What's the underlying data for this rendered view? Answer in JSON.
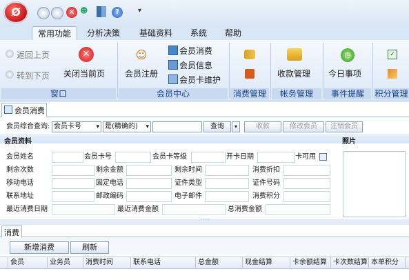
{
  "ribbon": {
    "tabs": [
      "常用功能",
      "分析决策",
      "基础资料",
      "系统",
      "帮助"
    ],
    "active_tab": "常用功能",
    "window_group": {
      "label": "窗口",
      "prev": "返回上页",
      "next": "转到下页",
      "close": "关闭当前页"
    },
    "member_group": {
      "label": "会员中心",
      "register": "会员注册",
      "consume": "会员消费",
      "info": "会员信息",
      "card": "会员卡维护"
    },
    "consume_group": {
      "label": "消费管理"
    },
    "account_group": {
      "label": "帐务管理",
      "receive": "收款管理"
    },
    "event_group": {
      "label": "事件提醒",
      "today": "今日事项"
    },
    "points_group": {
      "label": "积分管理"
    }
  },
  "doc_tab": {
    "label": "会员消费"
  },
  "search": {
    "label": "会员综合查询:",
    "field": "会员卡号",
    "match": "是(精确的)",
    "query": "查询",
    "receive": "收款",
    "edit": "修改会员",
    "cancel": "注销会员"
  },
  "info": {
    "title": "会员资料",
    "photo": "照片",
    "row1": [
      "会员姓名",
      "会员卡号",
      "会员卡等级",
      "开卡日期",
      "卡可用"
    ],
    "row2": [
      "剩余次数",
      "剩余金额",
      "剩余时间",
      "消费折扣"
    ],
    "row3": [
      "移动电话",
      "固定电话",
      "证件类型",
      "证件号码"
    ],
    "row4": [
      "联系地址",
      "邮政编码",
      "电子邮件",
      "消费积分"
    ],
    "row5": [
      "最近消费日期",
      "最近消费金额",
      "总消费金额"
    ]
  },
  "consume": {
    "tab": "消费",
    "add": "新增消费",
    "refresh": "刷新",
    "columns": [
      "会员",
      "业务员",
      "消费时间",
      "联系电话",
      "总金额",
      "现金结算",
      "卡余额结算",
      "卡次数结算",
      "本单积分"
    ]
  },
  "colors": {
    "accent": "#15428b",
    "ribbon": "#dbe8f7",
    "orb": "#c40d0d"
  }
}
